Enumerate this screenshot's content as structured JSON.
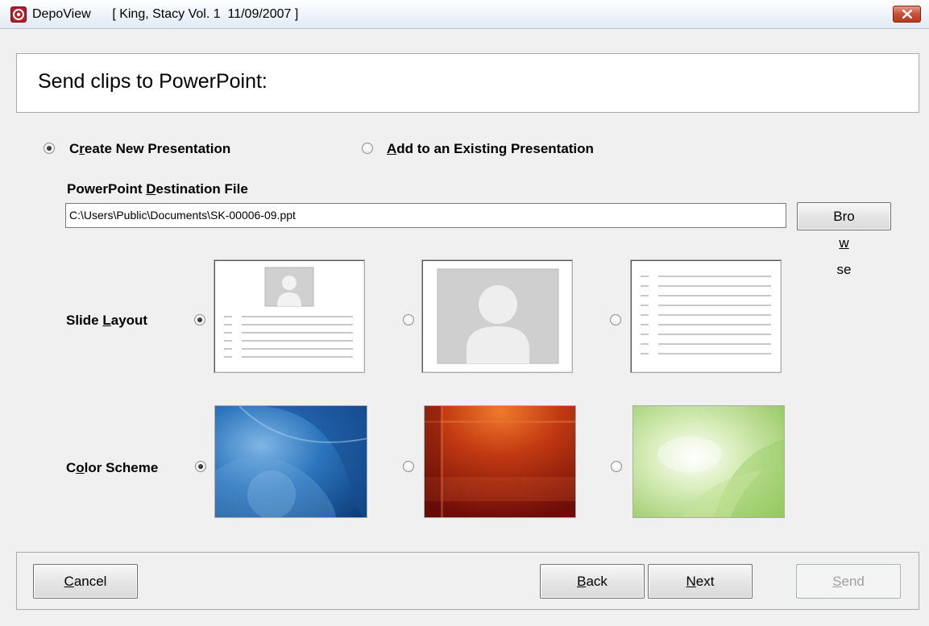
{
  "window": {
    "app_name": "DepoView",
    "document": "[ King, Stacy Vol. 1  11/09/2007 ]",
    "icon": "depoview-app-icon",
    "close_icon": "close-icon"
  },
  "header": {
    "title": "Send clips to PowerPoint:"
  },
  "mode": {
    "create_new": {
      "pre": "C",
      "key": "r",
      "post": "eate New Presentation",
      "checked": true
    },
    "add_existing": {
      "pre": "",
      "key": "A",
      "post": "dd to an Existing Presentation",
      "checked": false
    }
  },
  "destination": {
    "label_pre": "PowerPoint ",
    "label_key": "D",
    "label_post": "estination File",
    "value": "C:\\Users\\Public\\Documents\\SK-00006-09.ppt",
    "browse": {
      "pre": "Bro",
      "key": "w",
      "post": "se"
    }
  },
  "slide_layout": {
    "label_pre": "Slide ",
    "label_key": "L",
    "label_post": "ayout",
    "options": [
      {
        "name": "image-above-text-layout",
        "checked": true
      },
      {
        "name": "image-only-layout",
        "checked": false
      },
      {
        "name": "text-only-layout",
        "checked": false
      }
    ]
  },
  "color_scheme": {
    "label_pre": "C",
    "label_key": "o",
    "label_post": "lor Scheme",
    "options": [
      {
        "name": "blue-scheme",
        "color": "#2a73bb",
        "checked": true
      },
      {
        "name": "red-scheme",
        "color": "#b8300e",
        "checked": false
      },
      {
        "name": "green-scheme",
        "color": "#b5d889",
        "checked": false
      }
    ]
  },
  "footer": {
    "cancel": {
      "pre": "",
      "key": "C",
      "post": "ancel"
    },
    "back": {
      "pre": "",
      "key": "B",
      "post": "ack"
    },
    "next": {
      "pre": "",
      "key": "N",
      "post": "ext"
    },
    "send": {
      "pre": "",
      "key": "S",
      "post": "end",
      "enabled": false
    }
  }
}
